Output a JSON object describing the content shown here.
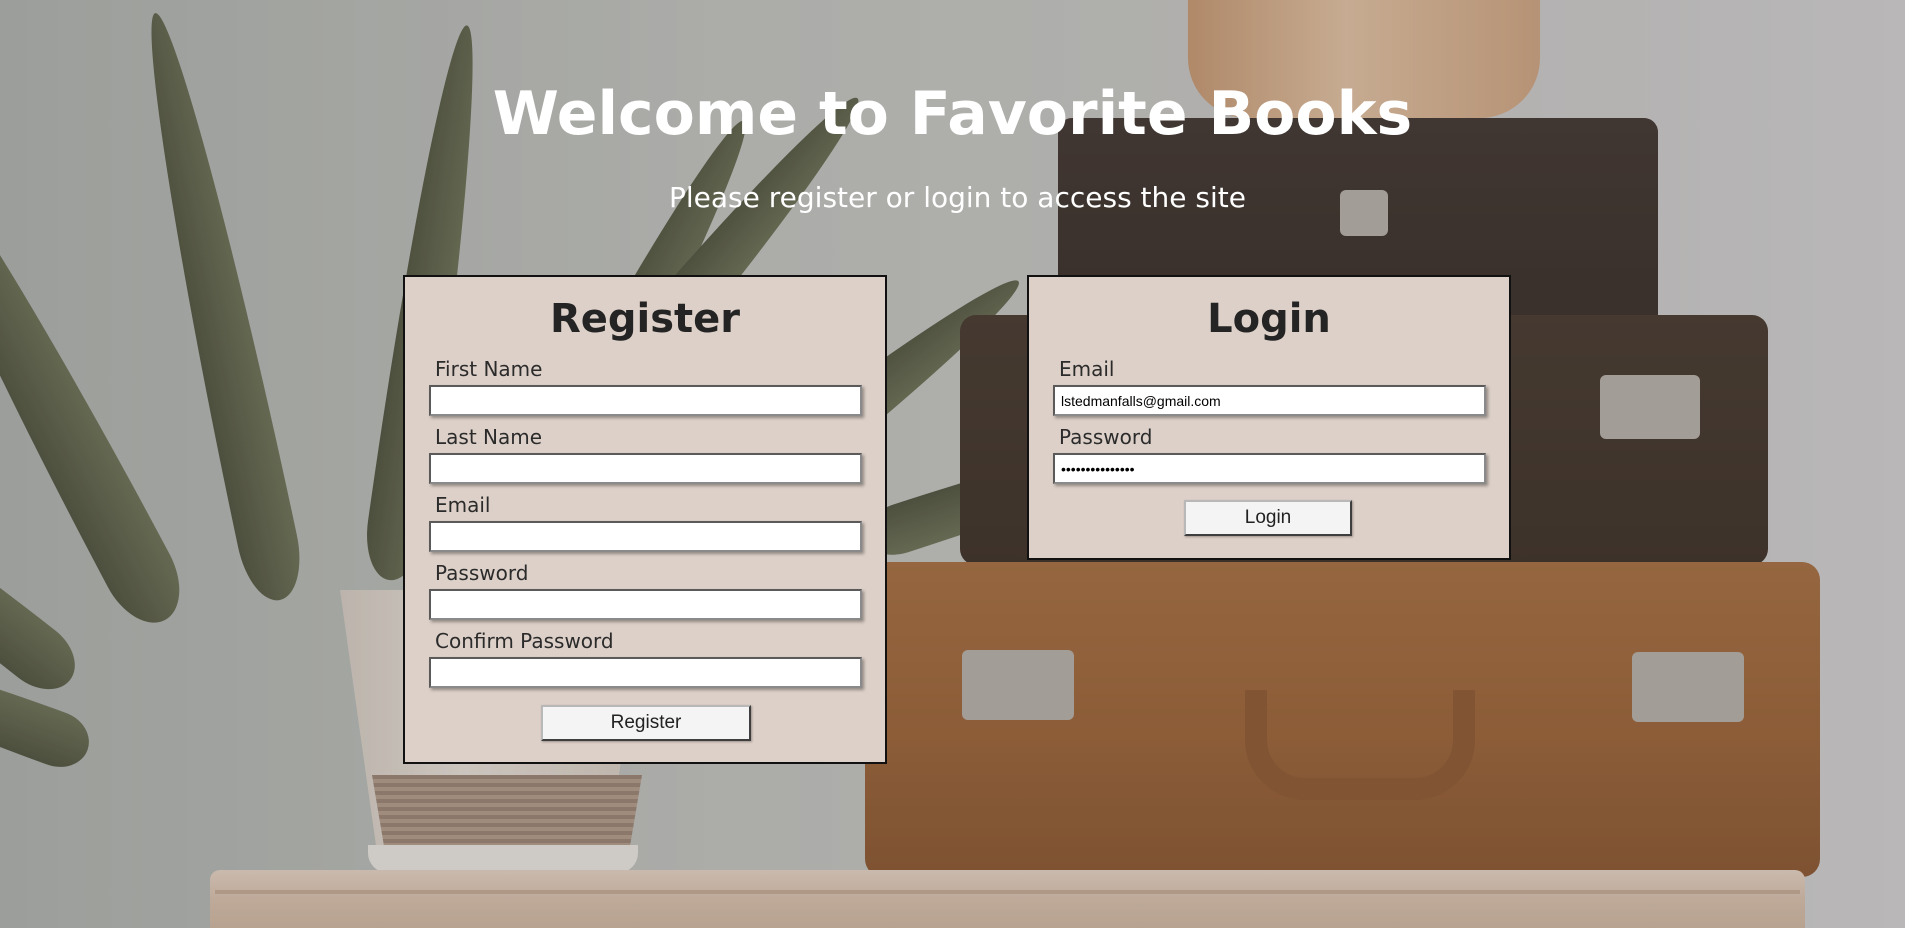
{
  "page": {
    "title": "Welcome to Favorite Books",
    "subtitle": "Please register or login to access the site"
  },
  "register": {
    "title": "Register",
    "fields": [
      {
        "label": "First Name",
        "value": "",
        "type": "text"
      },
      {
        "label": "Last Name",
        "value": "",
        "type": "text"
      },
      {
        "label": "Email",
        "value": "",
        "type": "text"
      },
      {
        "label": "Password",
        "value": "",
        "type": "password"
      },
      {
        "label": "Confirm Password",
        "value": "",
        "type": "password"
      }
    ],
    "submit_label": "Register"
  },
  "login": {
    "title": "Login",
    "fields": [
      {
        "label": "Email",
        "value": "lstedmanfalls@gmail.com",
        "type": "text"
      },
      {
        "label": "Password",
        "value": "passwordpasswor",
        "type": "password"
      }
    ],
    "submit_label": "Login"
  },
  "colors": {
    "card_background": "#ddd0c8",
    "card_border": "#111111",
    "heading_text": "#ffffff",
    "card_title_text": "#242424"
  }
}
